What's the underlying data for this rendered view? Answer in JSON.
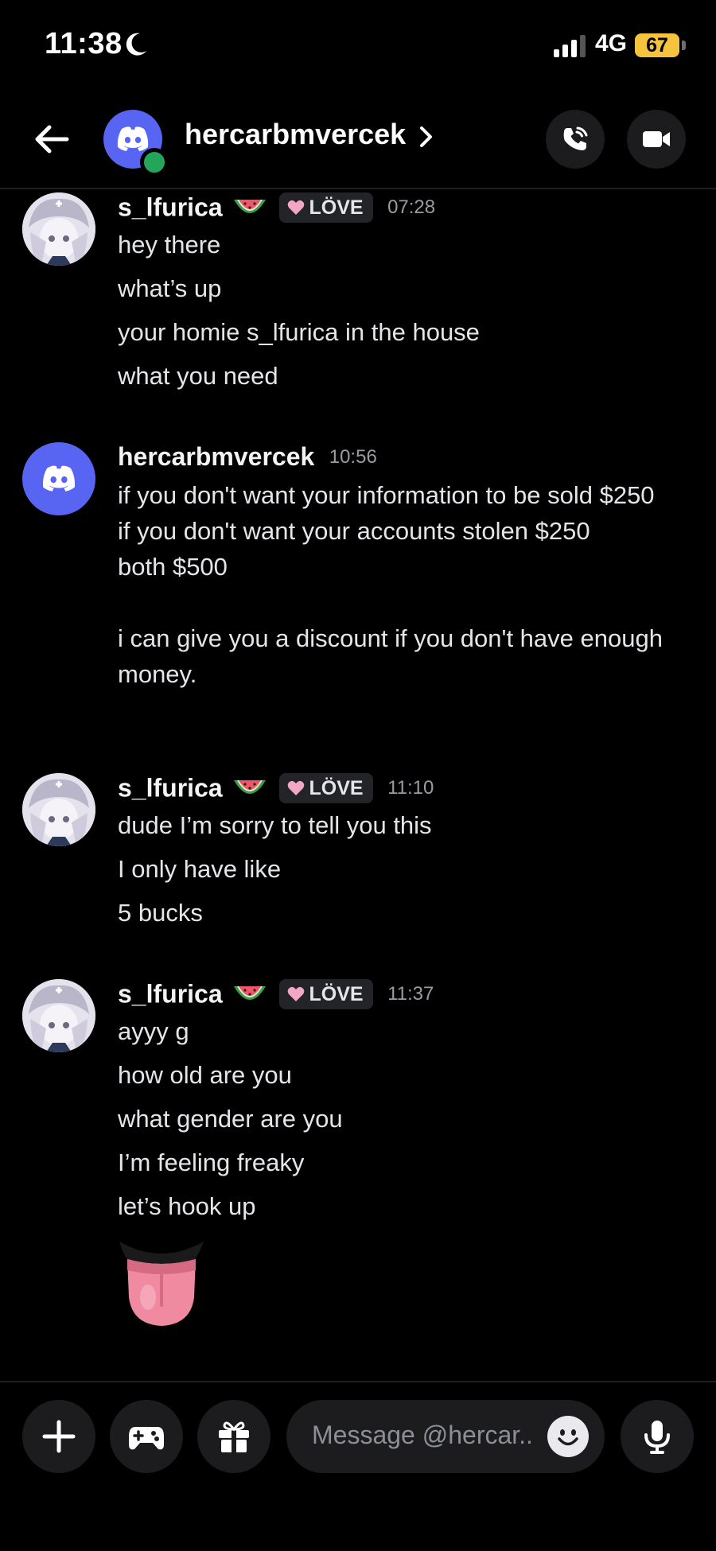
{
  "status": {
    "time": "11:38",
    "network": "4G",
    "battery": "67"
  },
  "header": {
    "name": "hercarbmvercek"
  },
  "tag": {
    "label": "LÖVE"
  },
  "messages": [
    {
      "author": "s_lfurica",
      "time": "07:28",
      "lines": [
        "hey there",
        "what’s up",
        "your homie s_lfurica in the house",
        "what you need"
      ]
    },
    {
      "author": "hercarbmvercek",
      "time": "10:56",
      "text": "if you don't want your information to be sold $250\nif you don't want your accounts stolen $250\nboth $500\n\ni can give you a discount if you don't have enough money."
    },
    {
      "author": "s_lfurica",
      "time": "11:10",
      "lines": [
        "dude I’m sorry to tell you this",
        "I only have like",
        "5 bucks"
      ]
    },
    {
      "author": "s_lfurica",
      "time": "11:37",
      "lines": [
        "ayyy g",
        "how old are you",
        "what gender are you",
        "I’m feeling freaky",
        "let’s hook up"
      ]
    }
  ],
  "composer": {
    "placeholder": "Message @hercar.."
  },
  "colors": {
    "blurple": "#5865f2",
    "online": "#23a55a",
    "battery": "#f6c43c",
    "background": "#000000"
  },
  "icons": [
    "moon-icon",
    "signal-icon",
    "back-arrow-icon",
    "discord-logo-icon",
    "chevron-right-icon",
    "phone-icon",
    "video-camera-icon",
    "watermelon-icon",
    "heart-icon",
    "tongue-emoji",
    "plus-icon",
    "gamepad-icon",
    "gift-icon",
    "emoji-icon",
    "microphone-icon"
  ]
}
